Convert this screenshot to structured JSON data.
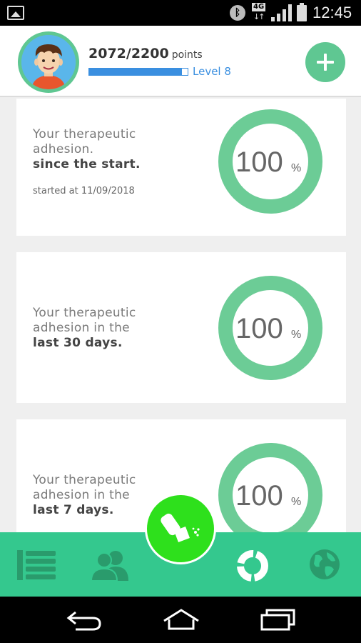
{
  "status_bar": {
    "network": "4G",
    "time": "12:45"
  },
  "header": {
    "points": "2072/2200",
    "points_suffix": "points",
    "progress_fraction": 0.942,
    "level": "Level 8",
    "add_button_icon": "plus-icon"
  },
  "cards": [
    {
      "line1": "Your therapeutic",
      "line2": "adhesion.",
      "line3": "since the start.",
      "sub": "started at 11/09/2018",
      "value": "100",
      "unit": "%",
      "percent": 100
    },
    {
      "line1": "Your therapeutic",
      "line2": "adhesion in the",
      "line3": "last 30 days.",
      "value": "100",
      "unit": "%",
      "percent": 100
    },
    {
      "line1": "Your therapeutic",
      "line2": "adhesion in the",
      "line3": "last 7 days.",
      "value": "100",
      "unit": "%",
      "percent": 100
    }
  ],
  "tabs": [
    {
      "icon": "list-icon"
    },
    {
      "icon": "people-icon"
    },
    {
      "icon": "inhaler-icon"
    },
    {
      "icon": "adhesion-chart-icon"
    },
    {
      "icon": "globe-icon"
    }
  ],
  "nav": [
    {
      "icon": "back-icon"
    },
    {
      "icon": "home-icon"
    },
    {
      "icon": "recent-apps-icon"
    }
  ],
  "colors": {
    "accent_green": "#34c88e",
    "ring_green": "#6ccc96",
    "fab_green": "#2ee01c",
    "level_blue": "#3a8fe0"
  }
}
